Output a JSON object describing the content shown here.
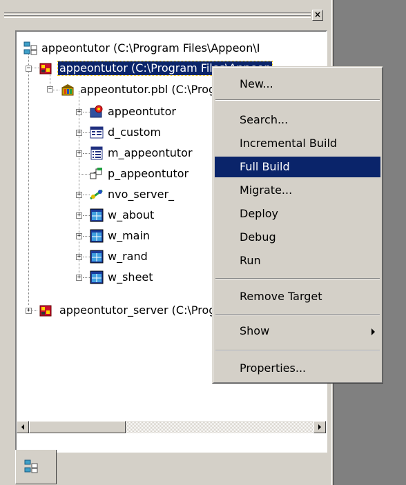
{
  "tree": {
    "workspace": "appeontutor (C:\\Program Files\\Appeon\\I",
    "target": "appeontutor (C:\\Program Files\\Appeon",
    "library": "appeontutor.pbl (C:\\Program Files",
    "objects": [
      "appeontutor",
      "d_custom",
      "m_appeontutor",
      "p_appeontutor",
      "nvo_server_",
      "w_about",
      "w_main",
      "w_rand",
      "w_sheet"
    ],
    "server_target": "appeontutor_server (C:\\Program Files"
  },
  "context_menu": {
    "items": [
      "New...",
      "Search...",
      "Incremental Build",
      "Full Build",
      "Migrate...",
      "Deploy",
      "Debug",
      "Run",
      "Remove Target",
      "Show",
      "Properties..."
    ],
    "highlighted": "Full Build"
  },
  "colors": {
    "selection": "#0a246a",
    "face": "#d4d0c8",
    "desktop": "#808080"
  },
  "icons": {
    "workspace": "workspace-icon",
    "target": "target-icon",
    "library": "library-icon",
    "application": "application-icon",
    "datawindow": "datawindow-icon",
    "menu": "menu-object-icon",
    "pipeline": "pipeline-icon",
    "userobject": "userobject-icon",
    "window": "window-icon"
  }
}
